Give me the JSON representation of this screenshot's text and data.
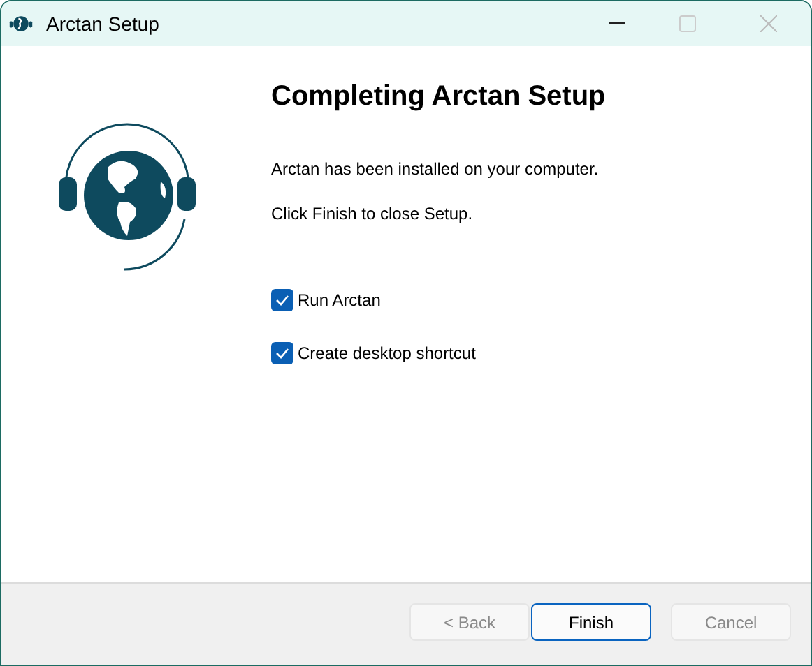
{
  "window": {
    "title": "Arctan Setup",
    "maximize_disabled": true
  },
  "heading": "Completing Arctan Setup",
  "paragraphs": [
    "Arctan has been installed on your computer.",
    "Click Finish to close Setup."
  ],
  "options": [
    {
      "label": "Run Arctan",
      "checked": true
    },
    {
      "label": "Create desktop shortcut",
      "checked": true
    }
  ],
  "buttons": [
    {
      "label": "< Back",
      "disabled": true,
      "default": false
    },
    {
      "label": "Finish",
      "disabled": false,
      "default": true
    },
    {
      "label": "Cancel",
      "disabled": true,
      "default": false
    }
  ]
}
